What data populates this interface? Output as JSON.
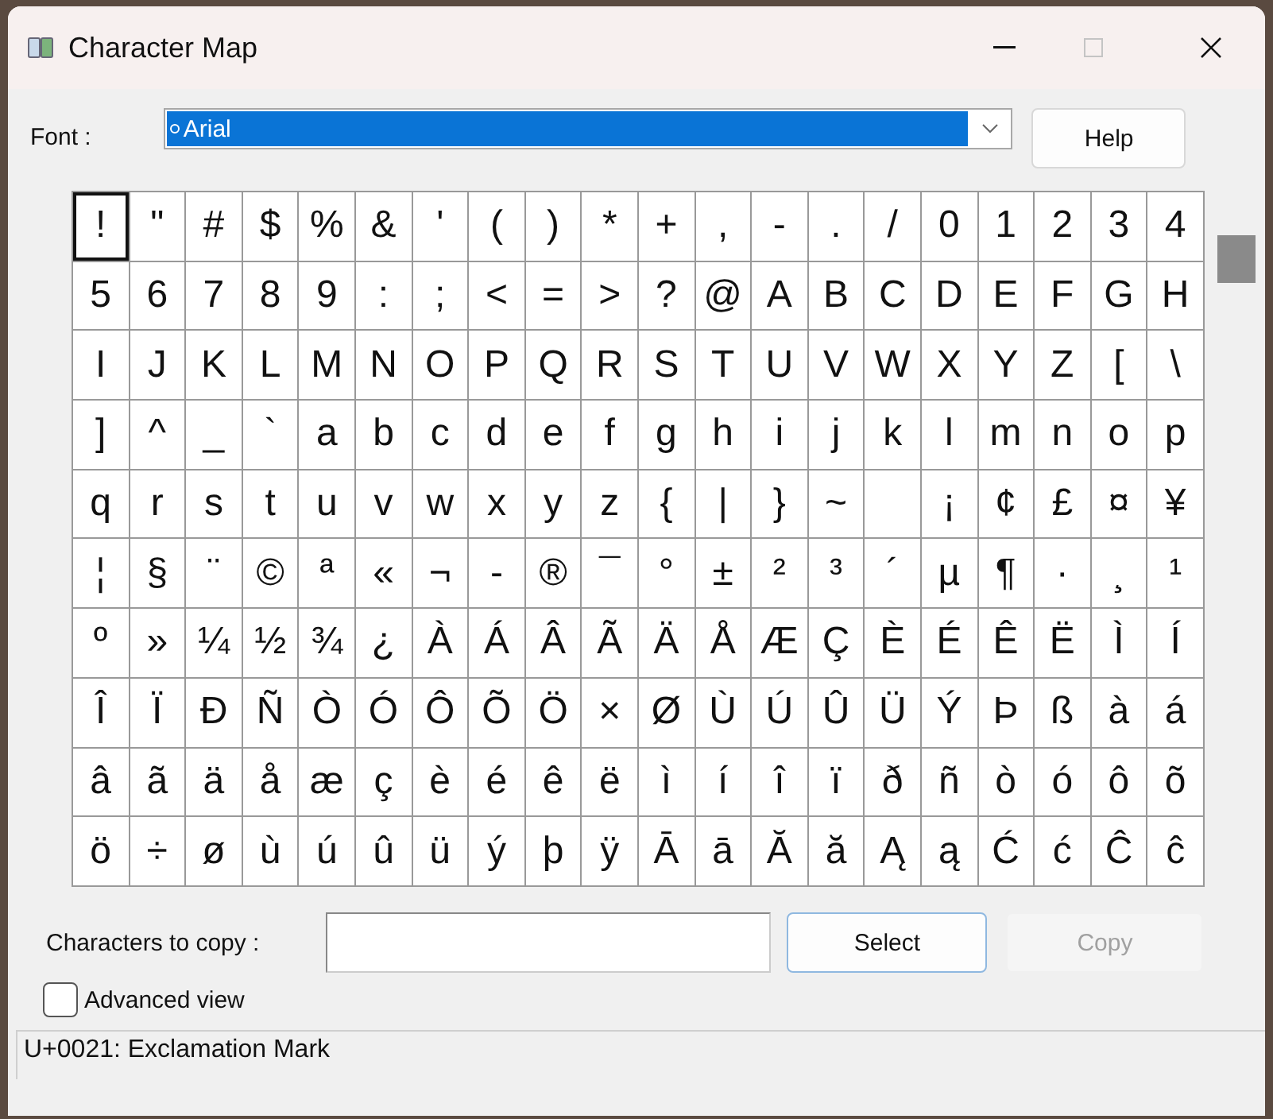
{
  "window": {
    "title": "Character Map",
    "maximize_disabled": true
  },
  "font": {
    "label": "Font :",
    "value": "Arial"
  },
  "help_button": {
    "label": "Help"
  },
  "grid": [
    [
      {
        "c": "!",
        "selected": true
      },
      {
        "c": "\"",
        "selected": false
      },
      {
        "c": "#",
        "selected": false
      },
      {
        "c": "$",
        "selected": false
      },
      {
        "c": "%",
        "selected": false
      },
      {
        "c": "&",
        "selected": false
      },
      {
        "c": "'",
        "selected": false
      },
      {
        "c": "(",
        "selected": false
      },
      {
        "c": ")",
        "selected": false
      },
      {
        "c": "*",
        "selected": false
      },
      {
        "c": "+",
        "selected": false
      },
      {
        "c": ",",
        "selected": false
      },
      {
        "c": "-",
        "selected": false
      },
      {
        "c": ".",
        "selected": false
      },
      {
        "c": "/",
        "selected": false
      },
      {
        "c": "0",
        "selected": false
      },
      {
        "c": "1",
        "selected": false
      },
      {
        "c": "2",
        "selected": false
      },
      {
        "c": "3",
        "selected": false
      },
      {
        "c": "4",
        "selected": false
      }
    ],
    [
      {
        "c": "5",
        "selected": false
      },
      {
        "c": "6",
        "selected": false
      },
      {
        "c": "7",
        "selected": false
      },
      {
        "c": "8",
        "selected": false
      },
      {
        "c": "9",
        "selected": false
      },
      {
        "c": ":",
        "selected": false
      },
      {
        "c": ";",
        "selected": false
      },
      {
        "c": "<",
        "selected": false
      },
      {
        "c": "=",
        "selected": false
      },
      {
        "c": ">",
        "selected": false
      },
      {
        "c": "?",
        "selected": false
      },
      {
        "c": "@",
        "selected": false
      },
      {
        "c": "A",
        "selected": false
      },
      {
        "c": "B",
        "selected": false
      },
      {
        "c": "C",
        "selected": false
      },
      {
        "c": "D",
        "selected": false
      },
      {
        "c": "E",
        "selected": false
      },
      {
        "c": "F",
        "selected": false
      },
      {
        "c": "G",
        "selected": false
      },
      {
        "c": "H",
        "selected": false
      }
    ],
    [
      {
        "c": "I",
        "selected": false
      },
      {
        "c": "J",
        "selected": false
      },
      {
        "c": "K",
        "selected": false
      },
      {
        "c": "L",
        "selected": false
      },
      {
        "c": "M",
        "selected": false
      },
      {
        "c": "N",
        "selected": false
      },
      {
        "c": "O",
        "selected": false
      },
      {
        "c": "P",
        "selected": false
      },
      {
        "c": "Q",
        "selected": false
      },
      {
        "c": "R",
        "selected": false
      },
      {
        "c": "S",
        "selected": false
      },
      {
        "c": "T",
        "selected": false
      },
      {
        "c": "U",
        "selected": false
      },
      {
        "c": "V",
        "selected": false
      },
      {
        "c": "W",
        "selected": false
      },
      {
        "c": "X",
        "selected": false
      },
      {
        "c": "Y",
        "selected": false
      },
      {
        "c": "Z",
        "selected": false
      },
      {
        "c": "[",
        "selected": false
      },
      {
        "c": "\\",
        "selected": false
      }
    ],
    [
      {
        "c": "]",
        "selected": false
      },
      {
        "c": "^",
        "selected": false
      },
      {
        "c": "_",
        "selected": false
      },
      {
        "c": "`",
        "selected": false
      },
      {
        "c": "a",
        "selected": false
      },
      {
        "c": "b",
        "selected": false
      },
      {
        "c": "c",
        "selected": false
      },
      {
        "c": "d",
        "selected": false
      },
      {
        "c": "e",
        "selected": false
      },
      {
        "c": "f",
        "selected": false
      },
      {
        "c": "g",
        "selected": false
      },
      {
        "c": "h",
        "selected": false
      },
      {
        "c": "i",
        "selected": false
      },
      {
        "c": "j",
        "selected": false
      },
      {
        "c": "k",
        "selected": false
      },
      {
        "c": "l",
        "selected": false
      },
      {
        "c": "m",
        "selected": false
      },
      {
        "c": "n",
        "selected": false
      },
      {
        "c": "o",
        "selected": false
      },
      {
        "c": "p",
        "selected": false
      }
    ],
    [
      {
        "c": "q",
        "selected": false
      },
      {
        "c": "r",
        "selected": false
      },
      {
        "c": "s",
        "selected": false
      },
      {
        "c": "t",
        "selected": false
      },
      {
        "c": "u",
        "selected": false
      },
      {
        "c": "v",
        "selected": false
      },
      {
        "c": "w",
        "selected": false
      },
      {
        "c": "x",
        "selected": false
      },
      {
        "c": "y",
        "selected": false
      },
      {
        "c": "z",
        "selected": false
      },
      {
        "c": "{",
        "selected": false
      },
      {
        "c": "|",
        "selected": false
      },
      {
        "c": "}",
        "selected": false
      },
      {
        "c": "~",
        "selected": false
      },
      {
        "selected": false
      },
      {
        "c": "¡",
        "selected": false
      },
      {
        "c": "¢",
        "selected": false
      },
      {
        "c": "£",
        "selected": false
      },
      {
        "c": "¤",
        "selected": false
      },
      {
        "c": "¥",
        "selected": false
      }
    ],
    [
      {
        "c": "¦",
        "selected": false
      },
      {
        "c": "§",
        "selected": false
      },
      {
        "c": "¨",
        "selected": false
      },
      {
        "c": "©",
        "selected": false
      },
      {
        "c": "ª",
        "selected": false
      },
      {
        "c": "«",
        "selected": false
      },
      {
        "c": "¬",
        "selected": false
      },
      {
        "c": "-",
        "selected": false
      },
      {
        "c": "®",
        "selected": false
      },
      {
        "c": "¯",
        "selected": false
      },
      {
        "c": "°",
        "selected": false
      },
      {
        "c": "±",
        "selected": false
      },
      {
        "c": "²",
        "selected": false
      },
      {
        "c": "³",
        "selected": false
      },
      {
        "c": "´",
        "selected": false
      },
      {
        "c": "µ",
        "selected": false
      },
      {
        "c": "¶",
        "selected": false
      },
      {
        "c": "·",
        "selected": false
      },
      {
        "c": "¸",
        "selected": false
      },
      {
        "c": "¹",
        "selected": false
      }
    ],
    [
      {
        "c": "º",
        "selected": false
      },
      {
        "c": "»",
        "selected": false
      },
      {
        "c": "¼",
        "selected": false
      },
      {
        "c": "½",
        "selected": false
      },
      {
        "c": "¾",
        "selected": false
      },
      {
        "c": "¿",
        "selected": false
      },
      {
        "c": "À",
        "selected": false
      },
      {
        "c": "Á",
        "selected": false
      },
      {
        "c": "Â",
        "selected": false
      },
      {
        "c": "Ã",
        "selected": false
      },
      {
        "c": "Ä",
        "selected": false
      },
      {
        "c": "Å",
        "selected": false
      },
      {
        "c": "Æ",
        "selected": false
      },
      {
        "c": "Ç",
        "selected": false
      },
      {
        "c": "È",
        "selected": false
      },
      {
        "c": "É",
        "selected": false
      },
      {
        "c": "Ê",
        "selected": false
      },
      {
        "c": "Ë",
        "selected": false
      },
      {
        "c": "Ì",
        "selected": false
      },
      {
        "c": "Í",
        "selected": false
      }
    ],
    [
      {
        "c": "Î",
        "selected": false
      },
      {
        "c": "Ï",
        "selected": false
      },
      {
        "c": "Ð",
        "selected": false
      },
      {
        "c": "Ñ",
        "selected": false
      },
      {
        "c": "Ò",
        "selected": false
      },
      {
        "c": "Ó",
        "selected": false
      },
      {
        "c": "Ô",
        "selected": false
      },
      {
        "c": "Õ",
        "selected": false
      },
      {
        "c": "Ö",
        "selected": false
      },
      {
        "c": "×",
        "selected": false
      },
      {
        "c": "Ø",
        "selected": false
      },
      {
        "c": "Ù",
        "selected": false
      },
      {
        "c": "Ú",
        "selected": false
      },
      {
        "c": "Û",
        "selected": false
      },
      {
        "c": "Ü",
        "selected": false
      },
      {
        "c": "Ý",
        "selected": false
      },
      {
        "c": "Þ",
        "selected": false
      },
      {
        "c": "ß",
        "selected": false
      },
      {
        "c": "à",
        "selected": false
      },
      {
        "c": "á",
        "selected": false
      }
    ],
    [
      {
        "c": "â",
        "selected": false
      },
      {
        "c": "ã",
        "selected": false
      },
      {
        "c": "ä",
        "selected": false
      },
      {
        "c": "å",
        "selected": false
      },
      {
        "c": "æ",
        "selected": false
      },
      {
        "c": "ç",
        "selected": false
      },
      {
        "c": "è",
        "selected": false
      },
      {
        "c": "é",
        "selected": false
      },
      {
        "c": "ê",
        "selected": false
      },
      {
        "c": "ë",
        "selected": false
      },
      {
        "c": "ì",
        "selected": false
      },
      {
        "c": "í",
        "selected": false
      },
      {
        "c": "î",
        "selected": false
      },
      {
        "c": "ï",
        "selected": false
      },
      {
        "c": "ð",
        "selected": false
      },
      {
        "c": "ñ",
        "selected": false
      },
      {
        "c": "ò",
        "selected": false
      },
      {
        "c": "ó",
        "selected": false
      },
      {
        "c": "ô",
        "selected": false
      },
      {
        "c": "õ",
        "selected": false
      }
    ],
    [
      {
        "c": "ö",
        "selected": false
      },
      {
        "c": "÷",
        "selected": false
      },
      {
        "c": "ø",
        "selected": false
      },
      {
        "c": "ù",
        "selected": false
      },
      {
        "c": "ú",
        "selected": false
      },
      {
        "c": "û",
        "selected": false
      },
      {
        "c": "ü",
        "selected": false
      },
      {
        "c": "ý",
        "selected": false
      },
      {
        "c": "þ",
        "selected": false
      },
      {
        "c": "ÿ",
        "selected": false
      },
      {
        "c": "Ā",
        "selected": false
      },
      {
        "c": "ā",
        "selected": false
      },
      {
        "c": "Ă",
        "selected": false
      },
      {
        "c": "ă",
        "selected": false
      },
      {
        "c": "Ą",
        "selected": false
      },
      {
        "c": "ą",
        "selected": false
      },
      {
        "c": "Ć",
        "selected": false
      },
      {
        "c": "ć",
        "selected": false
      },
      {
        "c": "Ĉ",
        "selected": false
      },
      {
        "c": "ĉ",
        "selected": false
      }
    ]
  ],
  "copy_row": {
    "label": "Characters to copy :",
    "select_button": "Select",
    "copy_button": {
      "label": "Copy",
      "disabled": true
    }
  },
  "advanced_view": {
    "label": "Advanced view",
    "checked": false
  },
  "status_bar": "U+0021: Exclamation Mark"
}
